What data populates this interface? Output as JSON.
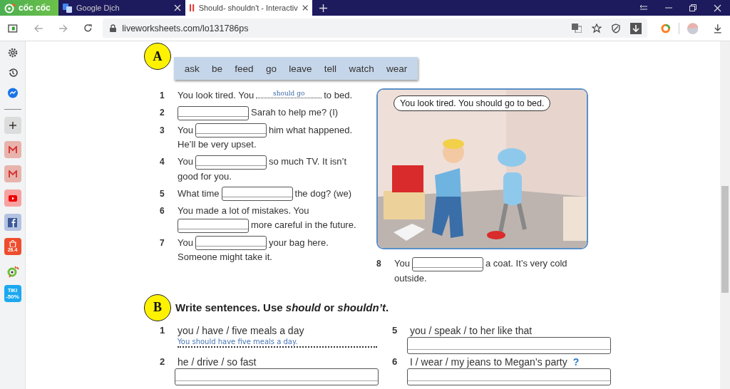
{
  "browser": {
    "logo": "cốc cốc",
    "tabs": [
      {
        "label": "Google Dịch",
        "selected": false
      },
      {
        "label": "Should- shouldn't - Interactiv",
        "selected": true
      }
    ],
    "address": "liveworksheets.com/lo131786ps"
  },
  "sidebar": {
    "shop_badge": "26.4",
    "sale_badge": {
      "brand": "TIKI",
      "offer": "-50%"
    }
  },
  "worksheet": {
    "section_a": {
      "letter": "A",
      "word_box": [
        "ask",
        "be",
        "feed",
        "go",
        "leave",
        "tell",
        "watch",
        "wear"
      ],
      "items": [
        {
          "number": "1",
          "parts": [
            {
              "kind": "text",
              "text": "You look tired. You"
            },
            {
              "kind": "answer",
              "text": "should go"
            },
            {
              "kind": "text",
              "text": "to bed."
            }
          ]
        },
        {
          "number": "2",
          "parts": [
            {
              "kind": "blank"
            },
            {
              "kind": "text",
              "text": "Sarah to help me? (I)"
            }
          ]
        },
        {
          "number": "3",
          "parts": [
            {
              "kind": "text",
              "text": "You"
            },
            {
              "kind": "blank"
            },
            {
              "kind": "text",
              "text": "him what happened."
            },
            {
              "kind": "text",
              "text": "He’ll be very upset."
            }
          ]
        },
        {
          "number": "4",
          "parts": [
            {
              "kind": "text",
              "text": "You"
            },
            {
              "kind": "blank"
            },
            {
              "kind": "text",
              "text": "so much TV. It isn’t"
            },
            {
              "kind": "text",
              "text": "good for you."
            }
          ]
        },
        {
          "number": "5",
          "parts": [
            {
              "kind": "text",
              "text": "What time"
            },
            {
              "kind": "blank"
            },
            {
              "kind": "text",
              "text": "the dog? (we)"
            }
          ]
        },
        {
          "number": "6",
          "parts": [
            {
              "kind": "text",
              "text": "You made a lot of mistakes. You"
            },
            {
              "kind": "blank"
            },
            {
              "kind": "text",
              "text": "more careful in the"
            },
            {
              "kind": "text",
              "text": "future."
            }
          ]
        },
        {
          "number": "7",
          "parts": [
            {
              "kind": "text",
              "text": "You"
            },
            {
              "kind": "blank"
            },
            {
              "kind": "text",
              "text": "your bag here."
            },
            {
              "kind": "text",
              "text": "Someone might take it."
            }
          ]
        }
      ],
      "illustration": {
        "kind": "picture",
        "speech": "You look tired. You should go to bed."
      },
      "picture_items": [
        {
          "number": "8",
          "parts": [
            {
              "kind": "text",
              "text": "You"
            },
            {
              "kind": "blank"
            },
            {
              "kind": "text",
              "text": "a coat. It’s very cold"
            },
            {
              "kind": "text",
              "text": "outside."
            }
          ]
        }
      ]
    },
    "section_b": {
      "letter": "B",
      "instruction": "Write sentences. Use *should* or *shouldn’t*.",
      "items": [
        {
          "number": "1",
          "prompt": "you / have / five meals a day",
          "kind": "answered",
          "answer": "You should have five meals a day."
        },
        {
          "number": "2",
          "prompt": "he / drive / so fast",
          "kind": "blank"
        },
        {
          "number": "5",
          "prompt": "you / speak / to her like that",
          "kind": "blank"
        },
        {
          "number": "6",
          "prompt": "I / wear / my jeans to Megan’s party",
          "kind": "blank",
          "hint": "?"
        }
      ]
    }
  }
}
